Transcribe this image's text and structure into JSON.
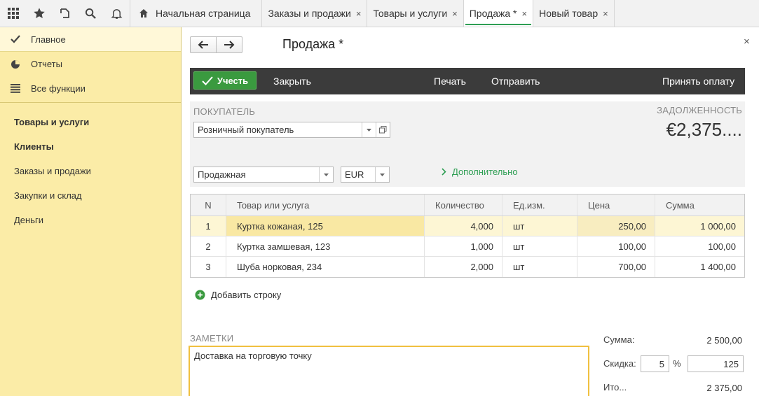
{
  "topbar": {
    "icons": [
      "apps-grid-icon",
      "star-icon",
      "history-icon",
      "search-icon",
      "bell-icon"
    ],
    "tabs": [
      {
        "label": "Начальная страница"
      },
      {
        "label": "Заказы и продажи"
      },
      {
        "label": "Товары и услуги"
      },
      {
        "label": "Продажа *"
      },
      {
        "label": "Новый товар"
      }
    ],
    "close_glyph": "×"
  },
  "sidebar": {
    "top_items": [
      {
        "label": "Главное",
        "icon": "check-icon"
      },
      {
        "label": "Отчеты",
        "icon": "pie-chart-icon"
      },
      {
        "label": "Все функции",
        "icon": "list-icon"
      }
    ],
    "sections": [
      {
        "label": "Товары и услуги"
      },
      {
        "label": "Клиенты"
      },
      {
        "label": "Заказы и продажи"
      },
      {
        "label": "Закупки и склад"
      },
      {
        "label": "Деньги"
      }
    ]
  },
  "document": {
    "title": "Продажа *",
    "close_glyph": "×"
  },
  "commands": {
    "post": "Учесть",
    "close": "Закрыть",
    "print": "Печать",
    "send": "Отправить",
    "accept_payment": "Принять оплату"
  },
  "header": {
    "buyer_label": "ПОКУПАТЕЛЬ",
    "buyer_value": "Розничный покупатель",
    "debt_label": "ЗАДОЛЖЕННОСТЬ",
    "debt_value": "€2,375....",
    "price_type": "Продажная",
    "currency": "EUR",
    "more": "Дополнительно"
  },
  "table": {
    "columns": [
      "N",
      "Товар или услуга",
      "Количество",
      "Ед.изм.",
      "Цена",
      "Сумма"
    ],
    "rows": [
      {
        "n": "1",
        "item": "Куртка кожаная, 125",
        "qty": "4,000",
        "unit": "шт",
        "price": "250,00",
        "sum": "1 000,00"
      },
      {
        "n": "2",
        "item": "Куртка замшевая, 123",
        "qty": "1,000",
        "unit": "шт",
        "price": "100,00",
        "sum": "100,00"
      },
      {
        "n": "3",
        "item": "Шуба норковая, 234",
        "qty": "2,000",
        "unit": "шт",
        "price": "700,00",
        "sum": "1 400,00"
      }
    ],
    "add_row": "Добавить строку"
  },
  "notes": {
    "label": "ЗАМЕТКИ",
    "text": "Доставка на торговую точку"
  },
  "totals": {
    "sum_label": "Сумма:",
    "sum_value": "2 500,00",
    "discount_label": "Скидка:",
    "discount_percent": "5",
    "percent_sign": "%",
    "discount_amount": "125",
    "total_label": "Ито...",
    "total_value": "2 375,00"
  },
  "colors": {
    "accent_green": "#3a9a3f",
    "sidebar_bg": "#fbeca7",
    "command_bar": "#3b3b3b",
    "focus_border": "#f0c040"
  }
}
